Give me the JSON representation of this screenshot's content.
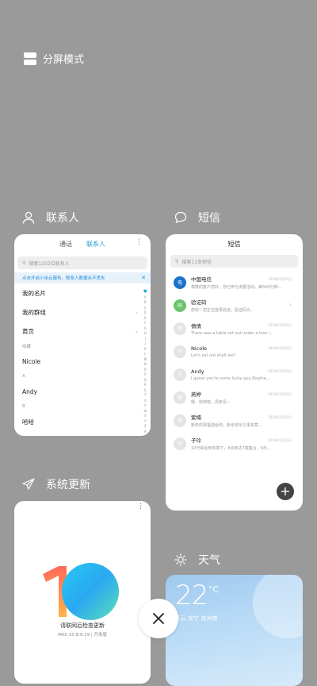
{
  "split_screen": {
    "label": "分屏模式",
    "icon": "split-screen-icon"
  },
  "contacts_app": {
    "title": "联系人",
    "icon": "person-icon",
    "tabs": [
      "通话",
      "联系人"
    ],
    "active_tab": "联系人",
    "search_placeholder": "搜索1202位联系人",
    "banner": "点击开启小米云服务，联系人数据永不丢失",
    "rows": [
      "我的名片",
      "我的群组",
      "黄页"
    ],
    "section_favorites": "收藏",
    "contacts": [
      {
        "section": "",
        "name": "Nicole"
      },
      {
        "section": "A",
        "name": "Andy"
      },
      {
        "section": "B",
        "name": "哈哈"
      }
    ],
    "index_letters": [
      "A",
      "B",
      "C",
      "D",
      "E",
      "F",
      "G",
      "H",
      "I",
      "J",
      "K",
      "L",
      "M",
      "N",
      "O",
      "P",
      "Q",
      "R",
      "S",
      "T",
      "U",
      "V",
      "W",
      "X",
      "Y",
      "Z",
      "#"
    ]
  },
  "sms_app": {
    "title": "短信",
    "icon": "chat-bubble-icon",
    "header": "短信",
    "search_placeholder": "搜索11条短信",
    "messages": [
      {
        "name": "中国电信",
        "msg": "尊敬的客户您好，您已参与流量活动，每500分钟...",
        "time": "2019年5月20日",
        "avatar": "电",
        "color": "#1a73c8"
      },
      {
        "name": "验证码",
        "msg": "您好！您正在登录验证，验证码为...",
        "time": "",
        "avatar": "码",
        "color": "#6cc36c"
      },
      {
        "name": "倩倩",
        "msg": "There was a table set out under a tree i...",
        "time": "2019年5月20日",
        "avatar": "倩",
        "color": "#e4e4e4"
      },
      {
        "name": "Nicole",
        "msg": "Let's eat out,shall we?",
        "time": "2019年5月20日",
        "avatar": "N",
        "color": "#e4e4e4"
      },
      {
        "name": "Andy",
        "msg": "I guess you're some lucky guy,Stepha...",
        "time": "2019年5月20日",
        "avatar": "A",
        "color": "#e4e4e4"
      },
      {
        "name": "燕婷",
        "msg": "嗯，收到啦，周末见~",
        "time": "2019年5月20日",
        "avatar": "燕",
        "color": "#e4e4e4"
      },
      {
        "name": "紫楠",
        "msg": "新年的祝福送给你，新年快乐万事如意...",
        "time": "2019年5月20日",
        "avatar": "紫",
        "color": "#e4e4e4"
      },
      {
        "name": "子玲",
        "msg": "10分钟后到你楼下，8点到达7楼集合，6日...",
        "time": "2019年5月20日",
        "avatar": "子",
        "color": "#e4e4e4"
      }
    ],
    "fab": "+"
  },
  "update_app": {
    "title": "系统更新",
    "icon": "paper-plane-icon",
    "logo_text": "10",
    "line1": "请联网后检查更新",
    "line2": "MIUI 10 8.9.19 | 开发版"
  },
  "weather_app": {
    "title": "天气",
    "icon": "sun-icon",
    "temperature": "22",
    "unit": "°C",
    "location": "多云 安宁 苏州南"
  },
  "close_button": {
    "icon": "close-icon"
  }
}
